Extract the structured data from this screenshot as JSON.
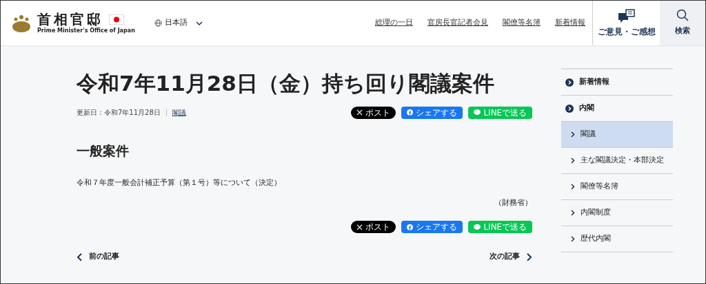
{
  "header": {
    "logo_ja": "首相官邸",
    "logo_en": "Prime Minister's Office of Japan",
    "language": "日本語",
    "nav": [
      "総理の一日",
      "官房長官記者会見",
      "閣僚等名簿",
      "新着情報"
    ],
    "feedback": "ご意見・ご感想",
    "search": "検索"
  },
  "article": {
    "title": "令和7年11月28日（金）持ち回り閣議案件",
    "updated": "更新日：令和7年11月28日",
    "category": "閣議",
    "share": [
      {
        "kind": "x",
        "label": "ポスト"
      },
      {
        "kind": "facebook",
        "label": "シェアする"
      },
      {
        "kind": "line",
        "label": "LINEで送る"
      }
    ],
    "section": "一般案件",
    "item": "令和７年度一般会計補正予算（第１号）等について（決定）",
    "ministry": "（財務省）",
    "share_bottom": [
      {
        "kind": "x",
        "label": "ポスト"
      },
      {
        "kind": "facebook",
        "label": "シェアする"
      },
      {
        "kind": "line",
        "label": "LINEで送る"
      }
    ],
    "prev": "前の記事",
    "next": "次の記事"
  },
  "sidebar": [
    {
      "kind": "top",
      "label": "新着情報",
      "selected": false
    },
    {
      "kind": "top",
      "label": "内閣",
      "selected": false
    },
    {
      "kind": "sub",
      "label": "閣議",
      "selected": true
    },
    {
      "kind": "sub",
      "label": "主な閣議決定・本部決定",
      "selected": false
    },
    {
      "kind": "sub",
      "label": "閣僚等名簿",
      "selected": false
    },
    {
      "kind": "sub",
      "label": "内閣制度",
      "selected": false
    },
    {
      "kind": "sub",
      "label": "歴代内閣",
      "selected": false
    }
  ]
}
